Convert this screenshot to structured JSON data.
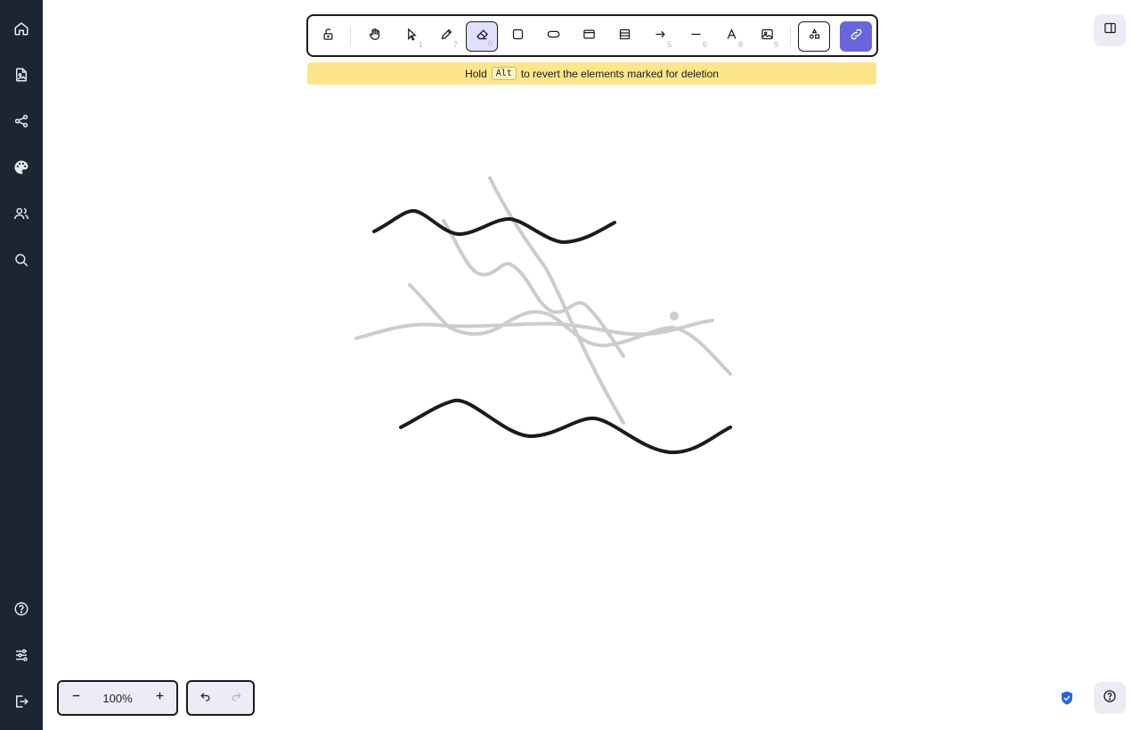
{
  "sidebar": {
    "items": [
      {
        "icon": "home-icon",
        "label": "Home"
      },
      {
        "icon": "image-file-icon",
        "label": "Files"
      },
      {
        "icon": "share-network-icon",
        "label": "Share"
      },
      {
        "icon": "palette-icon",
        "label": "Theme"
      },
      {
        "icon": "users-icon",
        "label": "Collaborators"
      },
      {
        "icon": "search-icon",
        "label": "Search"
      }
    ],
    "bottom_items": [
      {
        "icon": "help-circle-icon",
        "label": "Help"
      },
      {
        "icon": "sliders-icon",
        "label": "Settings"
      },
      {
        "icon": "logout-icon",
        "label": "Sign out"
      }
    ]
  },
  "toolbar": {
    "tools": [
      {
        "name": "lock",
        "icon": "unlock-icon",
        "key": ""
      },
      {
        "name": "hand",
        "icon": "hand-icon",
        "key": ""
      },
      {
        "name": "selection",
        "icon": "pointer-icon",
        "key": "1"
      },
      {
        "name": "draw",
        "icon": "pencil-icon",
        "key": "7"
      },
      {
        "name": "eraser",
        "icon": "eraser-icon",
        "key": "0",
        "active": true
      },
      {
        "name": "rectangle",
        "icon": "square-icon",
        "key": ""
      },
      {
        "name": "rounded",
        "icon": "pill-icon",
        "key": ""
      },
      {
        "name": "frame",
        "icon": "window-icon",
        "key": ""
      },
      {
        "name": "table",
        "icon": "table-icon",
        "key": ""
      },
      {
        "name": "arrow",
        "icon": "arrow-right-icon",
        "key": "5"
      },
      {
        "name": "line",
        "icon": "line-icon",
        "key": "6"
      },
      {
        "name": "text",
        "icon": "text-icon",
        "key": "8"
      },
      {
        "name": "image",
        "icon": "image-icon",
        "key": "9"
      },
      {
        "name": "shapes-library",
        "icon": "shapes-icon",
        "key": ""
      },
      {
        "name": "share-link",
        "icon": "link-icon",
        "key": ""
      }
    ]
  },
  "hint": {
    "before": "Hold",
    "key": "Alt",
    "after": "to revert the elements marked for deletion"
  },
  "zoom": {
    "value": "100%"
  },
  "colors": {
    "sidebar_bg": "#1b2632",
    "accent": "#6965db",
    "active_tool_bg": "#e0dfff",
    "hint_bg": "#fde68a",
    "stroke": "#1b1b1f",
    "stroke_marked": "#cccccc",
    "shield": "#2563eb"
  }
}
